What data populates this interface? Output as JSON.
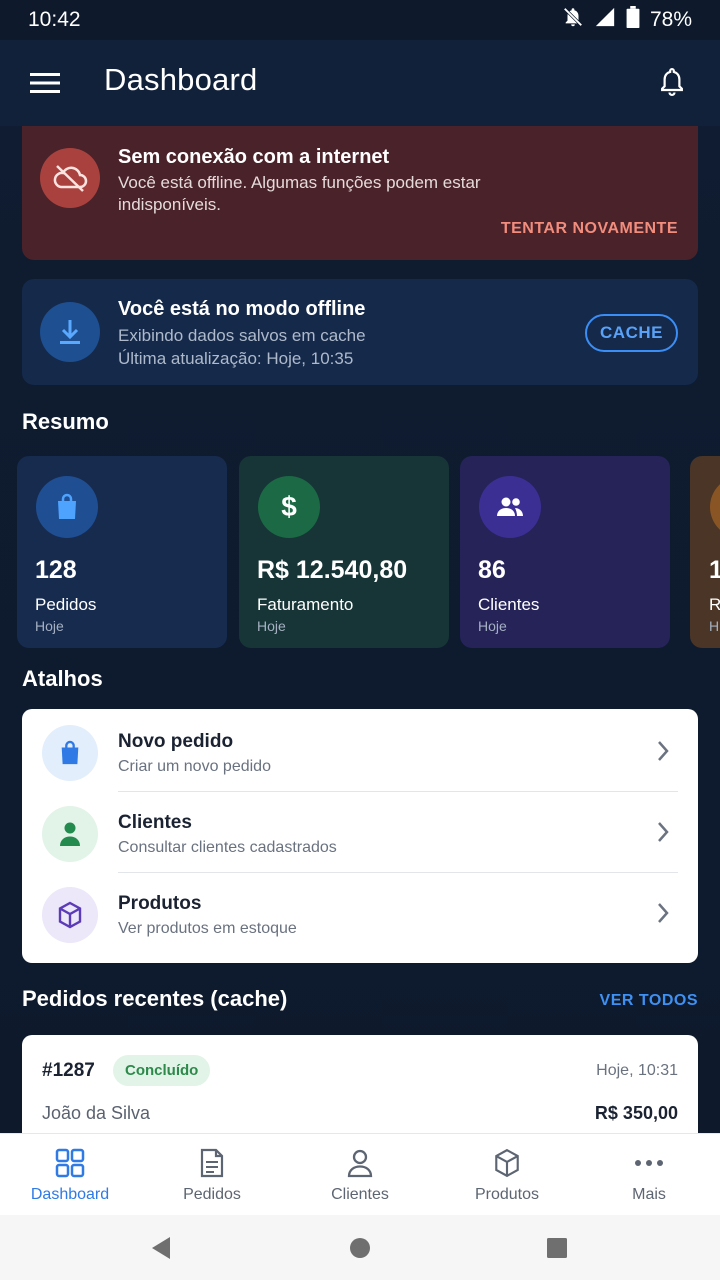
{
  "status_bar": {
    "time": "10:42",
    "battery": "78%"
  },
  "app_bar": {
    "title": "Dashboard"
  },
  "offline_banner": {
    "title": "Sem conexão com a internet",
    "message": "Você está offline. Algumas funções podem estar indisponíveis.",
    "retry_label": "TENTAR NOVAMENTE"
  },
  "offline_mode": {
    "title": "Você está no modo offline",
    "subtitle": "Exibindo dados salvos em cache",
    "last_update": "Última atualização: Hoje, 10:35",
    "cache_label": "CACHE"
  },
  "summary": {
    "title": "Resumo",
    "cards": [
      {
        "value": "128",
        "label": "Pedidos",
        "period": "Hoje",
        "icon": "shopping-bag-icon"
      },
      {
        "value": "R$ 12.540,80",
        "label": "Faturamento",
        "period": "Hoje",
        "icon": "dollar-icon"
      },
      {
        "value": "86",
        "label": "Clientes",
        "period": "Hoje",
        "icon": "users-icon"
      },
      {
        "value": "1",
        "label": "R",
        "period": "H",
        "icon": "generic-icon"
      }
    ]
  },
  "shortcuts": {
    "title": "Atalhos",
    "items": [
      {
        "title": "Novo pedido",
        "subtitle": "Criar um novo pedido",
        "icon": "shopping-bag-icon"
      },
      {
        "title": "Clientes",
        "subtitle": "Consultar clientes cadastrados",
        "icon": "person-icon"
      },
      {
        "title": "Produtos",
        "subtitle": "Ver produtos em estoque",
        "icon": "box-icon"
      }
    ]
  },
  "recent_orders": {
    "title": "Pedidos recentes (cache)",
    "see_all_label": "VER TODOS",
    "orders": [
      {
        "id": "#1287",
        "status": "Concluído",
        "time": "Hoje, 10:31",
        "customer": "João da Silva",
        "value": "R$ 350,00"
      }
    ]
  },
  "bottom_nav": {
    "items": [
      {
        "label": "Dashboard",
        "icon": "grid-icon",
        "active": true
      },
      {
        "label": "Pedidos",
        "icon": "document-icon"
      },
      {
        "label": "Clientes",
        "icon": "person-icon"
      },
      {
        "label": "Produtos",
        "icon": "box-icon"
      },
      {
        "label": "Mais",
        "icon": "more-icon"
      }
    ]
  },
  "colors": {
    "background": "#0f1b2e",
    "accent": "#3b8ef5",
    "error_bg": "#4a2229",
    "success": "#2d8a4b"
  }
}
